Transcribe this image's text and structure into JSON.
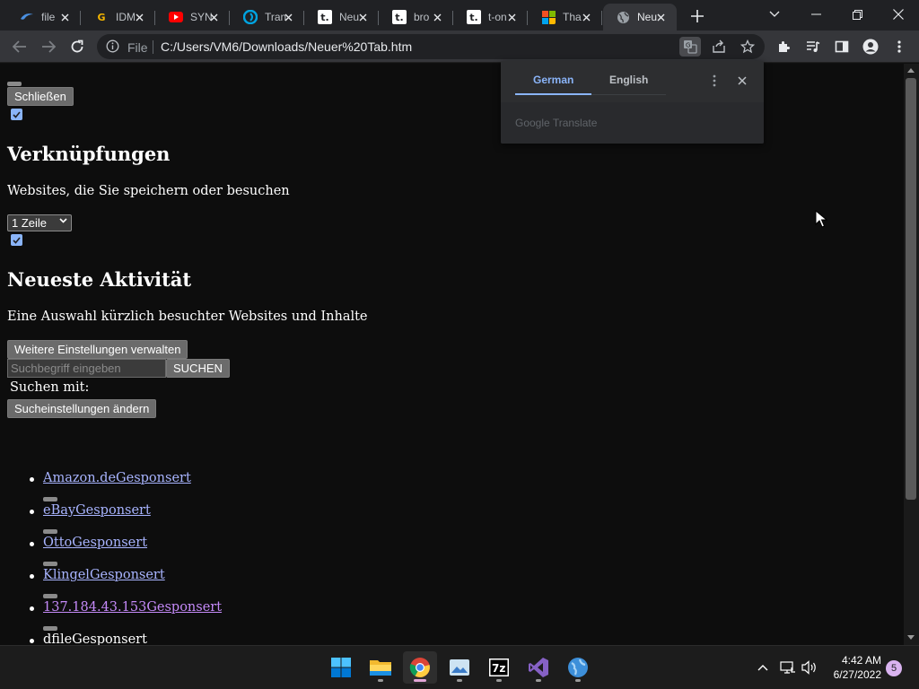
{
  "browser": {
    "tabs": [
      {
        "title": "file",
        "favicon": "blue-swirl-icon",
        "favicon_color": "#4a90e2"
      },
      {
        "title": "IDM",
        "favicon": "g-letter-icon",
        "favicon_color": "#f2b400"
      },
      {
        "title": "SYN",
        "favicon": "youtube-icon",
        "favicon_color": "#ff0000"
      },
      {
        "title": "Tran",
        "favicon": "translate-swirl-icon",
        "favicon_color": "#00a3e0"
      },
      {
        "title": "Neu",
        "favicon": "t-online-icon",
        "favicon_color": "#ffffff"
      },
      {
        "title": "bro",
        "favicon": "t-online-icon",
        "favicon_color": "#ffffff"
      },
      {
        "title": "t-on",
        "favicon": "t-online-icon",
        "favicon_color": "#ffffff"
      },
      {
        "title": "Tha",
        "favicon": "microsoft-icon",
        "favicon_color": "#f25022"
      },
      {
        "title": "Neu",
        "favicon": "globe-icon",
        "favicon_color": "#9aa0a6",
        "active": true
      }
    ],
    "omnibox": {
      "scheme_label": "File",
      "url": "C:/Users/VM6/Downloads/Neuer%20Tab.htm"
    }
  },
  "translate_popup": {
    "source_language": "German",
    "target_language": "English",
    "brand": "Google Translate"
  },
  "page": {
    "close_button": "Schließen",
    "shortcuts": {
      "heading": "Verknüpfungen",
      "description": "Websites, die Sie speichern oder besuchen",
      "rows_select": "1 Zeile",
      "checked": true
    },
    "recent_activity": {
      "heading": "Neueste Aktivität",
      "description": "Eine Auswahl kürzlich besuchter Websites und Inhalte",
      "checked": true
    },
    "manage_button": "Weitere Einstellungen verwalten",
    "search": {
      "placeholder": "Suchbegriff eingeben",
      "button": "SUCHEN",
      "search_with": "Suchen mit:",
      "settings_button": "Sucheinstellungen ändern"
    },
    "links": [
      {
        "name": "Amazon.de",
        "tag": "Gesponsert"
      },
      {
        "name": "eBay",
        "tag": "Gesponsert"
      },
      {
        "name": "Otto",
        "tag": "Gesponsert"
      },
      {
        "name": "Klingel",
        "tag": "Gesponsert"
      },
      {
        "name": "137.184.43.153",
        "tag": "Gesponsert"
      },
      {
        "name": "dfile",
        "tag": "Gesponsert"
      }
    ]
  },
  "taskbar": {
    "apps": [
      "windows-start-icon",
      "file-explorer-icon",
      "chrome-icon",
      "photos-icon",
      "7zip-icon",
      "visual-studio-icon",
      "globe-app-icon"
    ],
    "time": "4:42 AM",
    "date": "6/27/2022",
    "notifications": "5"
  }
}
